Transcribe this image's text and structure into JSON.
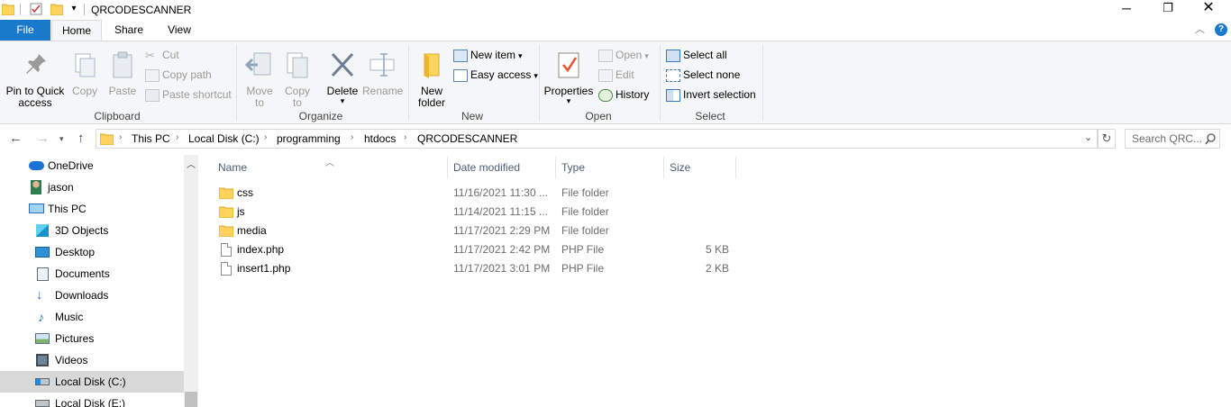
{
  "window": {
    "title": "QRCODESCANNER"
  },
  "tabs": [
    {
      "label": "File"
    },
    {
      "label": "Home"
    },
    {
      "label": "Share"
    },
    {
      "label": "View"
    }
  ],
  "ribbon": {
    "clipboard": {
      "pin": "Pin to Quick access",
      "pin_l1": "Pin to Quick",
      "pin_l2": "access",
      "copy": "Copy",
      "paste": "Paste",
      "cut": "Cut",
      "copy_path": "Copy path",
      "paste_shortcut": "Paste shortcut",
      "label": "Clipboard"
    },
    "organize": {
      "move_to_l1": "Move",
      "move_to_l2": "to",
      "copy_to_l1": "Copy",
      "copy_to_l2": "to",
      "delete": "Delete",
      "rename": "Rename",
      "label": "Organize"
    },
    "new": {
      "new_folder_l1": "New",
      "new_folder_l2": "folder",
      "new_item": "New item",
      "easy_access": "Easy access",
      "label": "New"
    },
    "open": {
      "properties": "Properties",
      "open": "Open",
      "edit": "Edit",
      "history": "History",
      "label": "Open"
    },
    "select": {
      "select_all": "Select all",
      "select_none": "Select none",
      "invert_selection": "Invert selection",
      "label": "Select"
    }
  },
  "address": {
    "crumbs": [
      "This PC",
      "Local Disk (C:)",
      "programming",
      "htdocs",
      "QRCODESCANNER"
    ],
    "search_placeholder": "Search QRC..."
  },
  "nav_items": [
    {
      "label": "OneDrive",
      "icon": "cloud-icon"
    },
    {
      "label": "jason",
      "icon": "user-icon"
    },
    {
      "label": "This PC",
      "icon": "computer-icon"
    },
    {
      "label": "3D Objects",
      "icon": "cube-icon"
    },
    {
      "label": "Desktop",
      "icon": "desktop-icon"
    },
    {
      "label": "Documents",
      "icon": "documents-icon"
    },
    {
      "label": "Downloads",
      "icon": "download-icon"
    },
    {
      "label": "Music",
      "icon": "music-icon"
    },
    {
      "label": "Pictures",
      "icon": "pictures-icon"
    },
    {
      "label": "Videos",
      "icon": "videos-icon"
    },
    {
      "label": "Local Disk (C:)",
      "icon": "drive-icon"
    },
    {
      "label": "Local Disk (E:)",
      "icon": "drive-icon"
    }
  ],
  "columns": {
    "name": "Name",
    "date": "Date modified",
    "type": "Type",
    "size": "Size"
  },
  "files": [
    {
      "name": "css",
      "date": "11/16/2021 11:30 ...",
      "type": "File folder",
      "size": "",
      "kind": "folder"
    },
    {
      "name": "js",
      "date": "11/14/2021 11:15 ...",
      "type": "File folder",
      "size": "",
      "kind": "folder"
    },
    {
      "name": "media",
      "date": "11/17/2021 2:29 PM",
      "type": "File folder",
      "size": "",
      "kind": "folder"
    },
    {
      "name": "index.php",
      "date": "11/17/2021 2:42 PM",
      "type": "PHP File",
      "size": "5 KB",
      "kind": "file"
    },
    {
      "name": "insert1.php",
      "date": "11/17/2021 3:01 PM",
      "type": "PHP File",
      "size": "2 KB",
      "kind": "file"
    }
  ],
  "colors": {
    "accent": "#1979ca",
    "folder": "#ffd35c",
    "selected": "#d9d9d9"
  }
}
